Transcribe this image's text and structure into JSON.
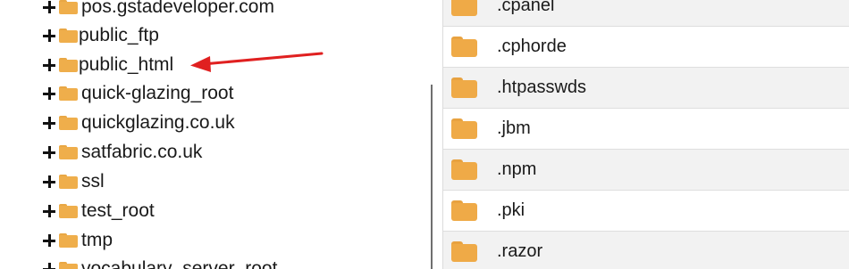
{
  "tree": {
    "items": [
      {
        "label": "pos.gstadeveloper.com"
      },
      {
        "label": "public_ftp"
      },
      {
        "label": "public_html"
      },
      {
        "label": "quick-glazing_root"
      },
      {
        "label": "quickglazing.co.uk"
      },
      {
        "label": "satfabric.co.uk"
      },
      {
        "label": "ssl"
      },
      {
        "label": "test_root"
      },
      {
        "label": "tmp"
      },
      {
        "label": "vocabulary_server_root"
      }
    ]
  },
  "files": {
    "items": [
      {
        "name": ".cpanel"
      },
      {
        "name": ".cphorde"
      },
      {
        "name": ".htpasswds"
      },
      {
        "name": ".jbm"
      },
      {
        "name": ".npm"
      },
      {
        "name": ".pki"
      },
      {
        "name": ".razor"
      }
    ]
  },
  "colors": {
    "folder": "#efae4b",
    "annotation_arrow": "#e02020",
    "row_shade": "#f2f2f2"
  }
}
